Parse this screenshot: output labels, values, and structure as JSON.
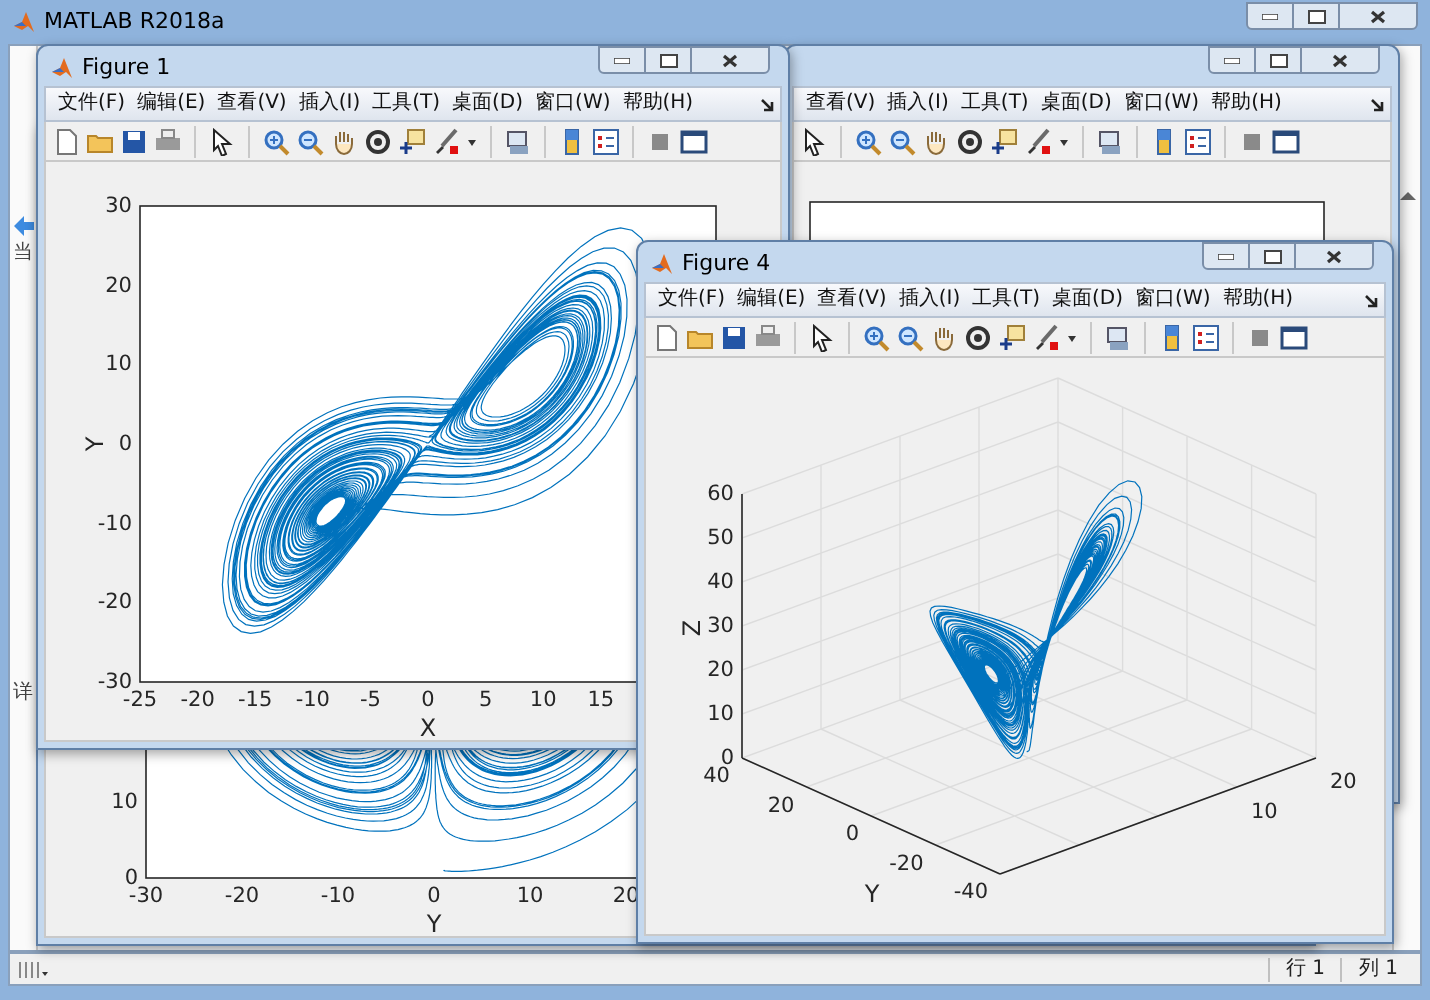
{
  "main_window": {
    "title": "MATLAB R2018a",
    "side_labels": [
      "当",
      "详"
    ],
    "status_bar": {
      "items": [
        "行 1",
        "列 1"
      ]
    }
  },
  "back_figure_bottom": {
    "axes": {
      "xticks": [
        "-30",
        "-20",
        "-10",
        "0",
        "10",
        "20"
      ],
      "yticks": [
        "10",
        "0"
      ],
      "xlabel": "Y"
    }
  },
  "back_figure_top": {
    "menu": [
      "查看(V)",
      "插入(I)",
      "工具(T)",
      "桌面(D)",
      "窗口(W)",
      "帮助(H)"
    ]
  },
  "figure_1": {
    "title": "Figure 1",
    "menu": [
      "文件(F)",
      "编辑(E)",
      "查看(V)",
      "插入(I)",
      "工具(T)",
      "桌面(D)",
      "窗口(W)",
      "帮助(H)"
    ],
    "axes": {
      "xticks": [
        "-25",
        "-20",
        "-15",
        "-10",
        "-5",
        "0",
        "5",
        "10",
        "15"
      ],
      "yticks": [
        "30",
        "20",
        "10",
        "0",
        "-10",
        "-20",
        "-30"
      ],
      "xlabel": "X",
      "ylabel": "Y"
    }
  },
  "figure_4": {
    "title": "Figure 4",
    "menu": [
      "文件(F)",
      "编辑(E)",
      "查看(V)",
      "插入(I)",
      "工具(T)",
      "桌面(D)",
      "窗口(W)",
      "帮助(H)"
    ],
    "axes": {
      "zticks": [
        "60",
        "50",
        "40",
        "30",
        "20",
        "10",
        "0"
      ],
      "yticks": [
        "40",
        "20",
        "0",
        "-20",
        "-40"
      ],
      "xticks": [
        "10",
        "20"
      ],
      "ylabel": "Y",
      "zlabel": "Z"
    }
  }
}
